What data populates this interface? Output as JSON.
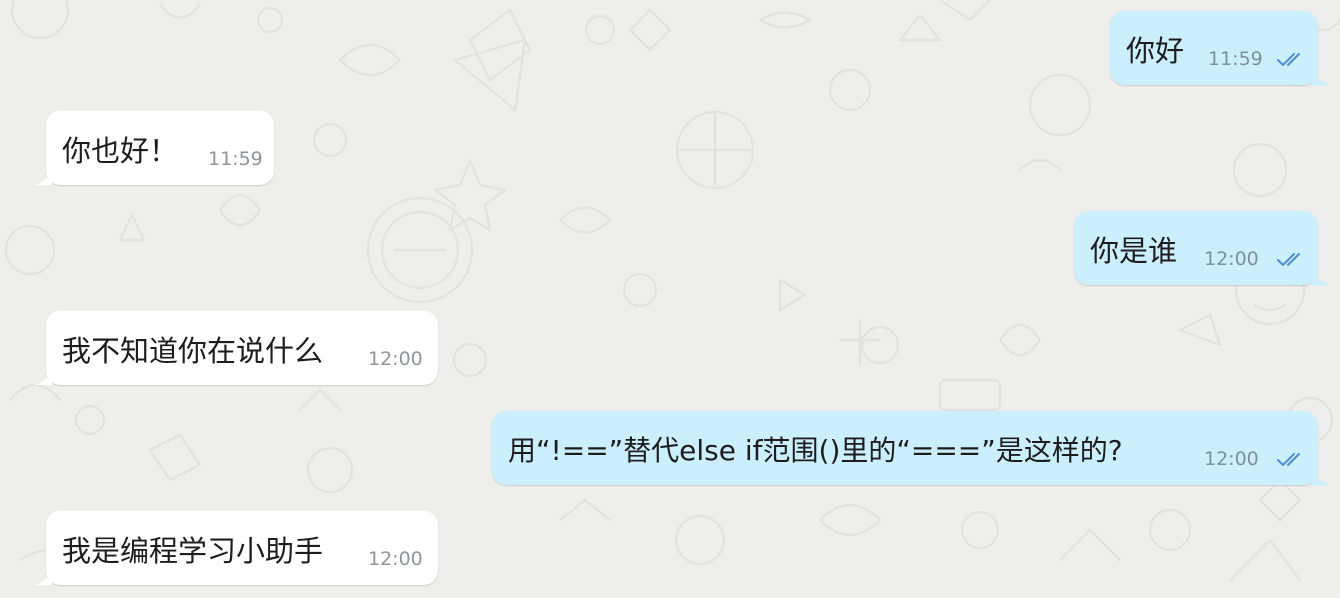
{
  "chat": {
    "messages": [
      {
        "direction": "outgoing",
        "text": "你好",
        "time": "11:59",
        "status_icon": "double-check-icon"
      },
      {
        "direction": "incoming",
        "text": "你也好！",
        "time": "11:59"
      },
      {
        "direction": "outgoing",
        "text": "你是谁",
        "time": "12:00",
        "status_icon": "double-check-icon"
      },
      {
        "direction": "incoming",
        "text": "我不知道你在说什么",
        "time": "12:00"
      },
      {
        "direction": "outgoing",
        "text": "用“!==”替代else if范围()里的“===”是这样的?",
        "time": "12:00",
        "status_icon": "double-check-icon"
      },
      {
        "direction": "incoming",
        "text": "我是编程学习小助手",
        "time": "12:00"
      }
    ]
  },
  "colors": {
    "background": "#eeeeec",
    "incoming_bubble": "#ffffff",
    "outgoing_bubble": "#cceffd",
    "read_check": "#4f8fd0",
    "timestamp": "#8b969d"
  }
}
